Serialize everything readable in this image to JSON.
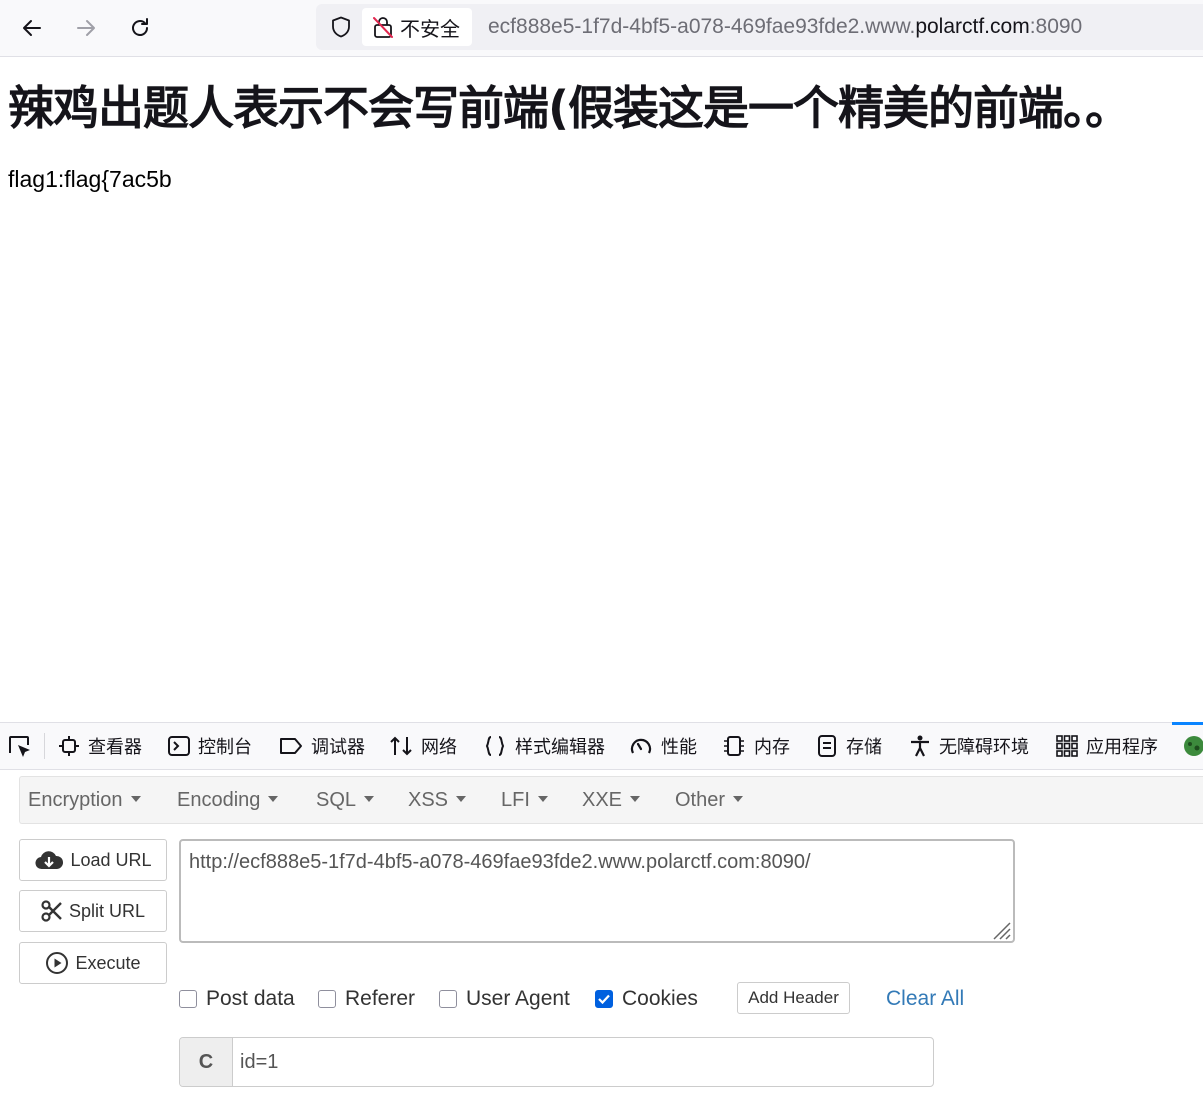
{
  "browser": {
    "insecure_label": "不安全",
    "url_prefix": "ecf888e5-1f7d-4bf5-a078-469fae93fde2.www.",
    "url_domain": "polarctf.com",
    "url_port": ":8090"
  },
  "page": {
    "heading": "辣鸡出题人表示不会写前端(假装这是一个精美的前端。。",
    "flag_text": "flag1:flag{7ac5b"
  },
  "devtools": {
    "tabs": [
      {
        "label": "查看器",
        "icon": "inspector-icon"
      },
      {
        "label": "控制台",
        "icon": "console-icon"
      },
      {
        "label": "调试器",
        "icon": "debugger-icon"
      },
      {
        "label": "网络",
        "icon": "network-icon"
      },
      {
        "label": "样式编辑器",
        "icon": "style-editor-icon"
      },
      {
        "label": "性能",
        "icon": "performance-icon"
      },
      {
        "label": "内存",
        "icon": "memory-icon"
      },
      {
        "label": "存储",
        "icon": "storage-icon"
      },
      {
        "label": "无障碍环境",
        "icon": "accessibility-icon"
      },
      {
        "label": "应用程序",
        "icon": "application-icon"
      }
    ]
  },
  "hackbar": {
    "menu": [
      "Encryption",
      "Encoding",
      "SQL",
      "XSS",
      "LFI",
      "XXE",
      "Other"
    ],
    "load_url": "Load URL",
    "split_url": "Split URL",
    "execute": "Execute",
    "url_value": "http://ecf888e5-1f7d-4bf5-a078-469fae93fde2.www.polarctf.com:8090/",
    "options": {
      "post_data": "Post data",
      "referer": "Referer",
      "user_agent": "User Agent",
      "cookies": "Cookies"
    },
    "add_header": "Add Header",
    "clear_all": "Clear All",
    "cookie_key": "C",
    "cookie_value": "id=1"
  },
  "colors": {
    "accent": "#0060df",
    "link": "#337ab7",
    "active_tab": "#0a84ff"
  }
}
